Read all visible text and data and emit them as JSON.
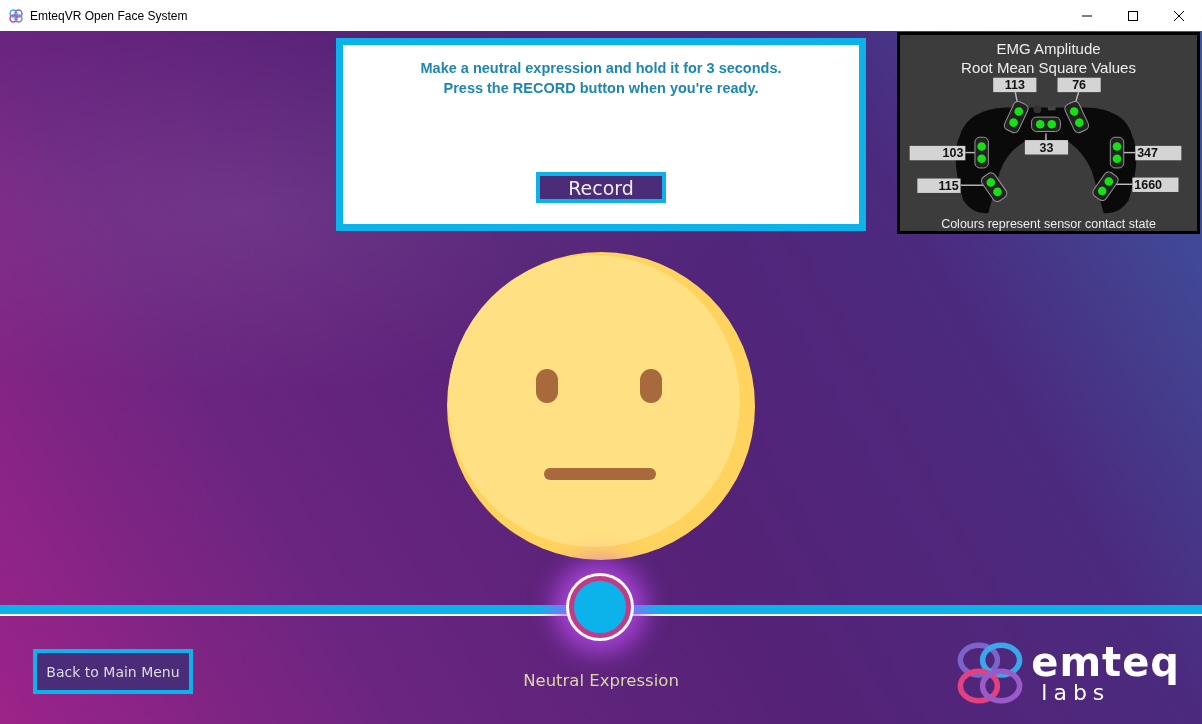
{
  "window": {
    "title": "EmteqVR Open Face System"
  },
  "prompt": {
    "lines": [
      "Make a neutral expression and hold it for 3 seconds.",
      "Press the RECORD button when you're ready."
    ],
    "button": "Record"
  },
  "emg_panel": {
    "title_lines": [
      "EMG Amplitude",
      "Root Mean Square Values"
    ],
    "sensors": [
      {
        "value": "113",
        "color": "#16e016"
      },
      {
        "value": "76",
        "color": "#16e016"
      },
      {
        "value": "33",
        "color": "#16e016"
      },
      {
        "value": "103",
        "color": "#16e016"
      },
      {
        "value": "347",
        "color": "#16e016"
      },
      {
        "value": "115",
        "color": "#16e016"
      },
      {
        "value": "1660",
        "color": "#16e016"
      }
    ],
    "caption": "Colours represent sensor contact state"
  },
  "expression_label": "Neutral Expression",
  "back_button": "Back to Main Menu",
  "logo": {
    "name": "emteq",
    "sub": "labs"
  }
}
